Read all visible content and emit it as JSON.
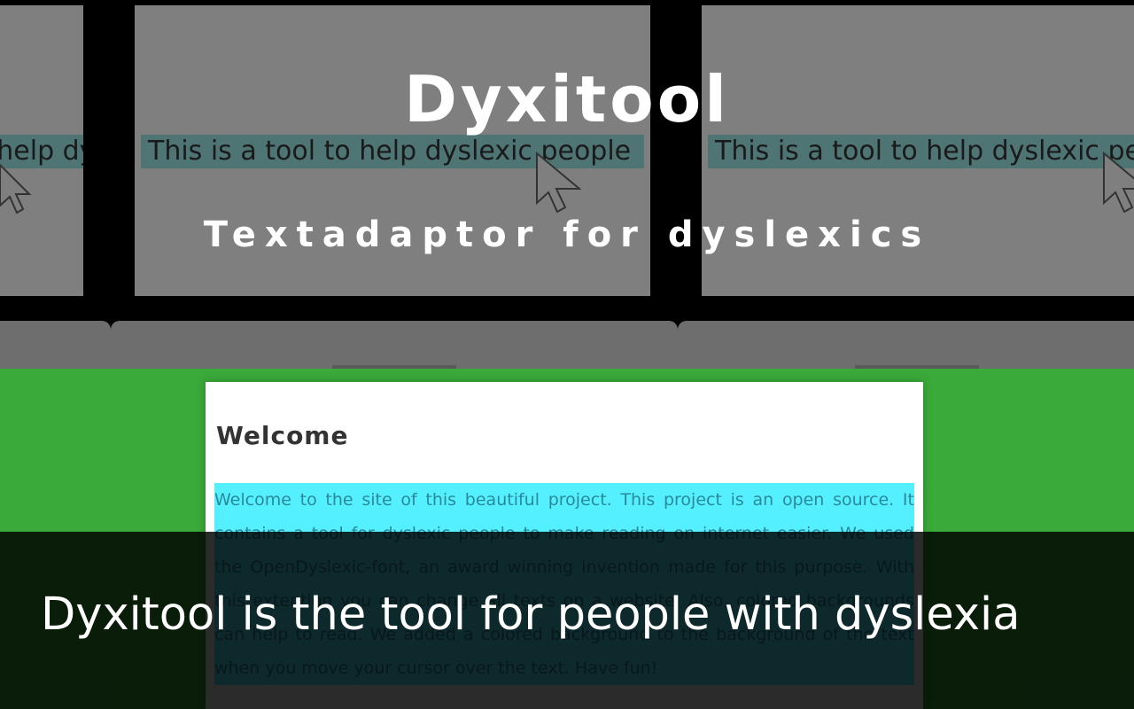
{
  "hero": {
    "title": "Dyxitool",
    "subtitle": "Textadaptor for dyslexics",
    "demo_screens": [
      {
        "text": "This is a tool to help dyslexic people"
      },
      {
        "text": "This is a tool to help dyslexic people"
      },
      {
        "text": "This is a tool to help dyslexic people"
      }
    ]
  },
  "main": {
    "heading": "Welcome",
    "body": "Welcome to the site of this beautiful project. This project is an open source. It contains a tool for dyslexic people to make reading on internet easier. We used the OpenDyslexic-font, an award winning invention made for this purpose. With this extention you can change all texts on a website. Also, colored backgrounds can help to read. We added a colored background to the background of the text when you move your cursor over the text. Have fun!"
  },
  "caption": {
    "text": "Dyxitool is the tool for people with dyslexia"
  },
  "colors": {
    "page_background": "#3aaa3a",
    "text_highlight": "#55f0ff",
    "overlay": "#000000"
  }
}
